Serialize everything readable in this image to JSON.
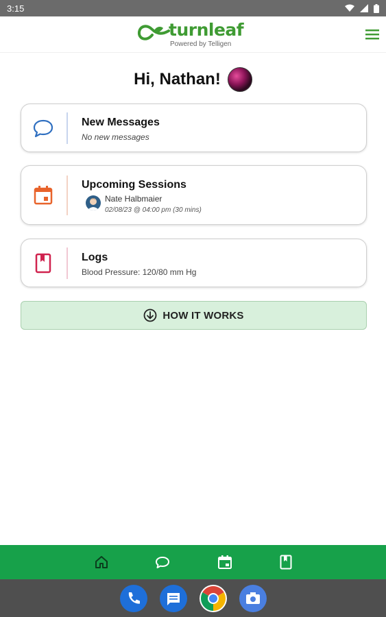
{
  "status_bar": {
    "time": "3:15"
  },
  "header": {
    "logo_name": "turnleaf",
    "logo_tagline": "Powered by Telligen"
  },
  "greeting": {
    "text": "Hi,  Nathan!"
  },
  "cards": {
    "messages": {
      "title": "New Messages",
      "subtitle": "No new messages",
      "icon": "chat-bubble-icon",
      "icon_color": "#2f6fc0"
    },
    "sessions": {
      "title": "Upcoming Sessions",
      "provider_name": "Nate Halbmaier",
      "datetime": "02/08/23 @ 04:00 pm (30 mins)",
      "icon": "calendar-icon",
      "icon_color": "#e8632b"
    },
    "logs": {
      "title": "Logs",
      "subtitle": "Blood Pressure: 120/80 mm Hg",
      "icon": "book-icon",
      "icon_color": "#d0234f"
    }
  },
  "how_it_works": {
    "label": "HOW IT WORKS",
    "icon": "arrow-down-circle-icon"
  },
  "bottom_nav": {
    "color": "#17a14a",
    "items": [
      "home-icon",
      "chat-icon",
      "calendar-icon",
      "book-icon"
    ]
  },
  "dock": {
    "apps": [
      "phone-icon",
      "messages-icon",
      "chrome-icon",
      "camera-icon"
    ]
  }
}
